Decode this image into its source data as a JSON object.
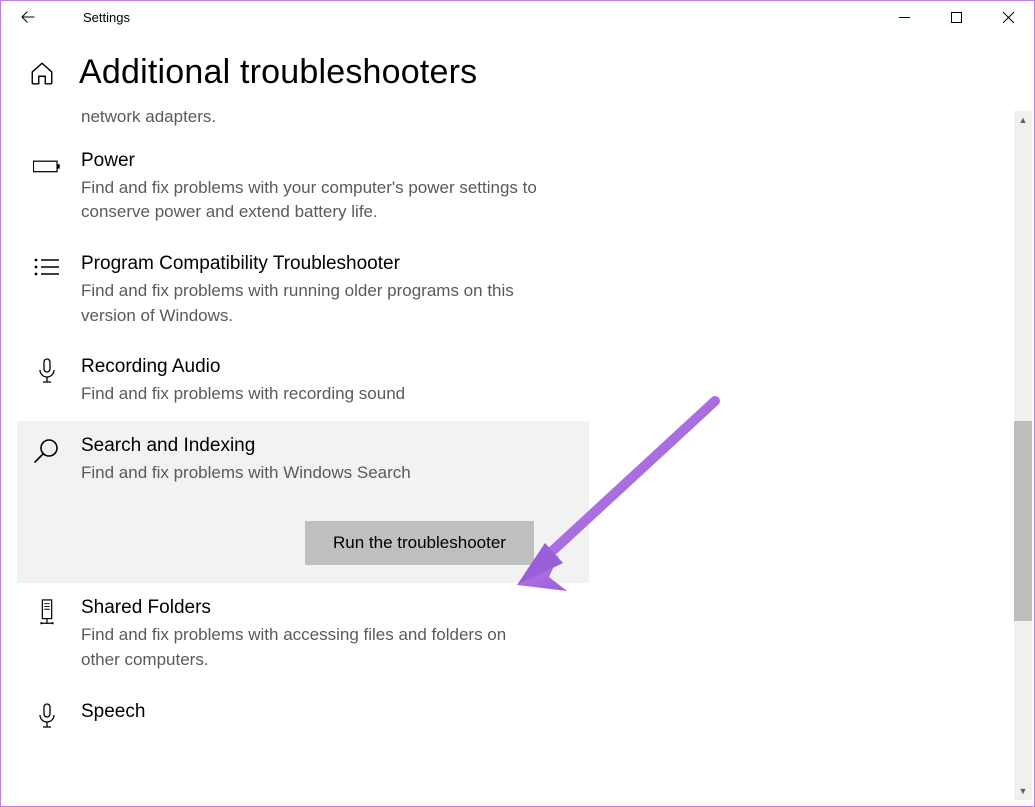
{
  "window": {
    "title": "Settings"
  },
  "page": {
    "title": "Additional troubleshooters"
  },
  "partial_top": {
    "desc": "network adapters."
  },
  "items": [
    {
      "title": "Power",
      "desc": "Find and fix problems with your computer's power settings to conserve power and extend battery life."
    },
    {
      "title": "Program Compatibility Troubleshooter",
      "desc": "Find and fix problems with running older programs on this version of Windows."
    },
    {
      "title": "Recording Audio",
      "desc": "Find and fix problems with recording sound"
    },
    {
      "title": "Search and Indexing",
      "desc": "Find and fix problems with Windows Search",
      "button": "Run the troubleshooter"
    },
    {
      "title": "Shared Folders",
      "desc": "Find and fix problems with accessing files and folders on other computers."
    },
    {
      "title": "Speech",
      "desc": ""
    }
  ]
}
